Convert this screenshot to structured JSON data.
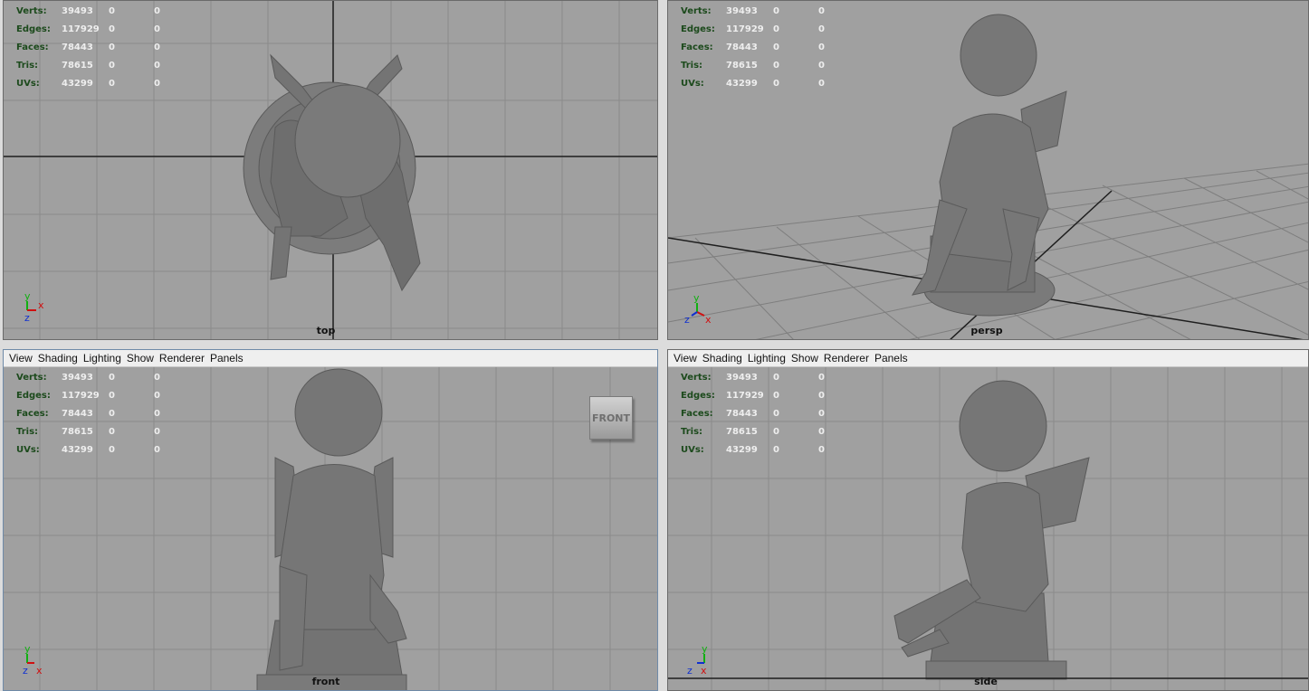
{
  "stats": {
    "rows": [
      {
        "label": "Verts:",
        "value": "39493",
        "sel1": "0",
        "sel2": "0"
      },
      {
        "label": "Edges:",
        "value": "117929",
        "sel1": "0",
        "sel2": "0"
      },
      {
        "label": "Faces:",
        "value": "78443",
        "sel1": "0",
        "sel2": "0"
      },
      {
        "label": "Tris:",
        "value": "78615",
        "sel1": "0",
        "sel2": "0"
      },
      {
        "label": "UVs:",
        "value": "43299",
        "sel1": "0",
        "sel2": "0"
      }
    ]
  },
  "menu": {
    "view": "View",
    "shading": "Shading",
    "lighting": "Lighting",
    "show": "Show",
    "renderer": "Renderer",
    "panels": "Panels"
  },
  "panels": {
    "top": {
      "camera": "top"
    },
    "persp": {
      "camera": "persp"
    },
    "front": {
      "camera": "front",
      "cube_label": "FRONT"
    },
    "side": {
      "camera": "side"
    }
  },
  "axis_labels": {
    "x": "x",
    "y": "y",
    "z": "z"
  },
  "colors": {
    "viewport_bg": "#a0a0a0",
    "grid": "#8a8a8a",
    "axis_line": "#1e1e1e",
    "hud_label": "#1c4a1c",
    "hud_value": "#eeeeee",
    "statue": "#777777",
    "x_axis": "#d01010",
    "y_axis": "#10b010",
    "z_axis": "#1030d0"
  }
}
